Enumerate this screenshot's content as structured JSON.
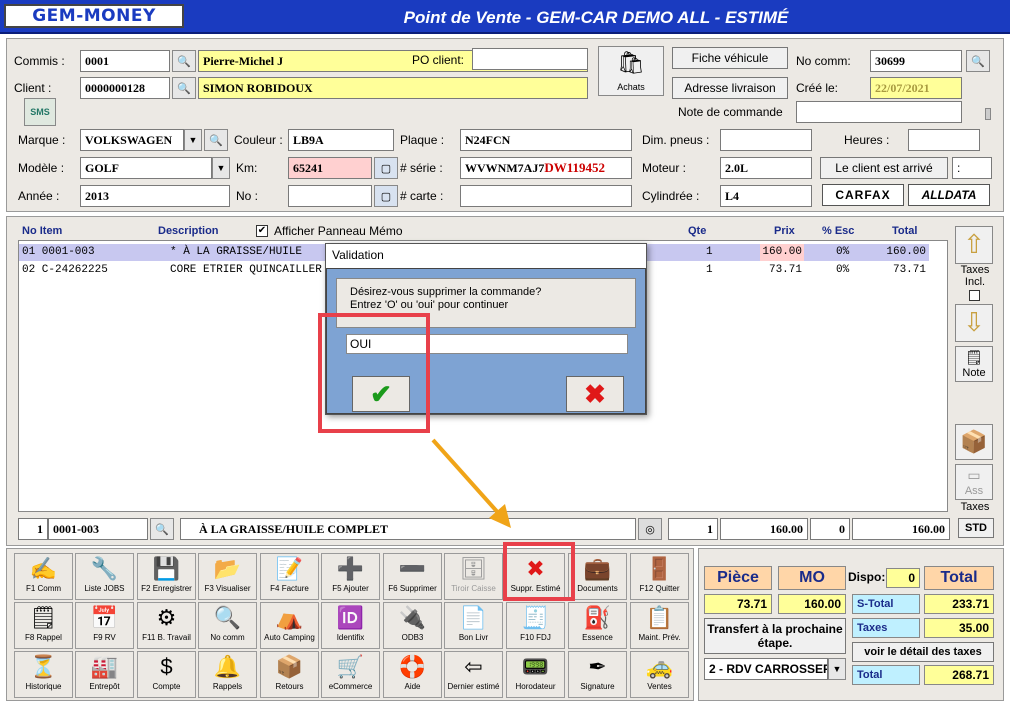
{
  "header": {
    "logo": "GEM-MONEY",
    "title": "Point de Vente - GEM-CAR DEMO ALL  - ESTIMÉ"
  },
  "form": {
    "commis_label": "Commis :",
    "commis_code": "0001",
    "commis_name": "Pierre-Michel J",
    "client_label": "Client :",
    "client_code": "0000000128",
    "client_name": "SIMON ROBIDOUX",
    "po_label": "PO client:",
    "po_value": "",
    "achats_label": "Achats",
    "fiche_btn": "Fiche véhicule",
    "adresse_btn": "Adresse livraison",
    "nocomm_label": "No comm:",
    "nocomm_value": "30699",
    "cree_label": "Créé le:",
    "cree_value": "22/07/2021",
    "note_label": "Note de commande",
    "note_value": "",
    "sms_label": "SMS",
    "marque_label": "Marque :",
    "marque_value": "VOLKSWAGEN",
    "couleur_label": "Couleur :",
    "couleur_value": "LB9A",
    "plaque_label": "Plaque :",
    "plaque_value": "N24FCN",
    "pneus_label": "Dim. pneus :",
    "pneus_value": "",
    "heures_label": "Heures :",
    "heures_value": "",
    "modele_label": "Modèle :",
    "modele_value": "GOLF",
    "km_label": "Km:",
    "km_value": "65241",
    "serie_label": "# série :",
    "serie_value_a": "WVWNM7AJ7",
    "serie_value_b": "DW119452",
    "moteur_label": "Moteur :",
    "moteur_value": "2.0L",
    "arrive_btn": "Le client est arrivé",
    "arrive_value": ":",
    "annee_label": "Année :",
    "annee_value": "2013",
    "no_label": "No :",
    "no_value": "",
    "carte_label": "# carte :",
    "carte_value": "",
    "cyl_label": "Cylindrée :",
    "cyl_value": "L4",
    "carfax": "CARFAX",
    "alldata": "ALLDATA"
  },
  "grid": {
    "headers": {
      "item": "No Item",
      "desc": "Description",
      "memo": "Afficher Panneau Mémo",
      "qte": "Qte",
      "prix": "Prix",
      "esc": "% Esc",
      "total": "Total"
    },
    "rows": [
      {
        "item": "01  0001-003",
        "desc": "*    À LA GRAISSE/HUILE",
        "qte": "1",
        "prix": "160.00",
        "esc": "0%",
        "total": "160.00"
      },
      {
        "item": "02  C-24262225",
        "desc": "CORE ETRIER QUINCAILLER",
        "qte": "1",
        "prix": "73.71",
        "esc": "0%",
        "total": "73.71"
      }
    ],
    "side": {
      "taxes_incl": "Taxes Incl.",
      "note": "Note",
      "ass": "Ass",
      "taxes": "Taxes",
      "std": "STD"
    },
    "edit": {
      "line": "1",
      "code": "0001-003",
      "desc": "À LA GRAISSE/HUILE COMPLET",
      "qte": "1",
      "prix": "160.00",
      "esc": "0",
      "total": "160.00"
    }
  },
  "dialog": {
    "title": "Validation",
    "message": "Désirez-vous supprimer la commande?\nEntrez 'O' ou 'oui' pour continuer",
    "input": "OUI"
  },
  "toolbar": [
    [
      {
        "n": "f1",
        "l": "F1 Comm",
        "i": "✍"
      },
      {
        "n": "liste-jobs",
        "l": "Liste JOBS",
        "i": "🔧"
      },
      {
        "n": "f2",
        "l": "F2 Enregistrer",
        "i": "💾"
      },
      {
        "n": "f3",
        "l": "F3 Visualiser",
        "i": "📂"
      },
      {
        "n": "f4",
        "l": "F4 Facture",
        "i": "📝"
      },
      {
        "n": "f5",
        "l": "F5 Ajouter",
        "i": "➕"
      },
      {
        "n": "f6",
        "l": "F6 Supprimer",
        "i": "➖"
      },
      {
        "n": "tiroir",
        "l": "Tiroir Caisse",
        "i": "🗄"
      },
      {
        "n": "suppr",
        "l": "Suppr. Estimé",
        "i": "✖"
      },
      {
        "n": "documents",
        "l": "Documents",
        "i": "💼"
      },
      {
        "n": "f12",
        "l": "F12 Quitter",
        "i": "🚪"
      }
    ],
    [
      {
        "n": "f8",
        "l": "F8 Rappel",
        "i": "🗒"
      },
      {
        "n": "f9",
        "l": "F9 RV",
        "i": "📅"
      },
      {
        "n": "f11",
        "l": "F11 B. Travail",
        "i": "⚙"
      },
      {
        "n": "nocomm",
        "l": "No comm",
        "i": "🔍"
      },
      {
        "n": "auto-camping",
        "l": "Auto Camping",
        "i": "⛺"
      },
      {
        "n": "identifix",
        "l": "Identifix",
        "i": "🆔"
      },
      {
        "n": "odb3",
        "l": "ODB3",
        "i": "🔌"
      },
      {
        "n": "bon-livr",
        "l": "Bon Livr",
        "i": "📄"
      },
      {
        "n": "f10",
        "l": "F10 FDJ",
        "i": "🧾"
      },
      {
        "n": "essence",
        "l": "Essence",
        "i": "⛽"
      },
      {
        "n": "maint",
        "l": "Maint. Prév.",
        "i": "📋"
      }
    ],
    [
      {
        "n": "historique",
        "l": "Historique",
        "i": "⏳"
      },
      {
        "n": "entrepot",
        "l": "Entrepôt",
        "i": "🏭"
      },
      {
        "n": "compte",
        "l": "Compte",
        "i": "$"
      },
      {
        "n": "rappels",
        "l": "Rappels",
        "i": "🔔"
      },
      {
        "n": "retours",
        "l": "Retours",
        "i": "📦"
      },
      {
        "n": "ecommerce",
        "l": "eCommerce",
        "i": "🛒"
      },
      {
        "n": "aide",
        "l": "Aide",
        "i": "🛟"
      },
      {
        "n": "dernier",
        "l": "Dernier estimé",
        "i": "⇦"
      },
      {
        "n": "horodateur",
        "l": "Horodateur",
        "i": "📟"
      },
      {
        "n": "signature",
        "l": "Signature",
        "i": "✒"
      },
      {
        "n": "ventes",
        "l": "Ventes",
        "i": "🚕"
      }
    ]
  ],
  "totals": {
    "piece_label": "Pièce",
    "mo_label": "MO",
    "dispo_label": "Dispo:",
    "dispo_value": "0",
    "total_label": "Total",
    "piece_value": "73.71",
    "mo_value": "160.00",
    "stotal_label": "S-Total",
    "stotal_value": "233.71",
    "transfert": "Transfert à la prochaine étape.",
    "taxes_label": "Taxes",
    "taxes_value": "35.00",
    "detail_btn": "voir le détail des taxes",
    "etape_value": "2 - RDV CARROSSEF",
    "total_row_label": "Total",
    "total_value": "268.71"
  }
}
